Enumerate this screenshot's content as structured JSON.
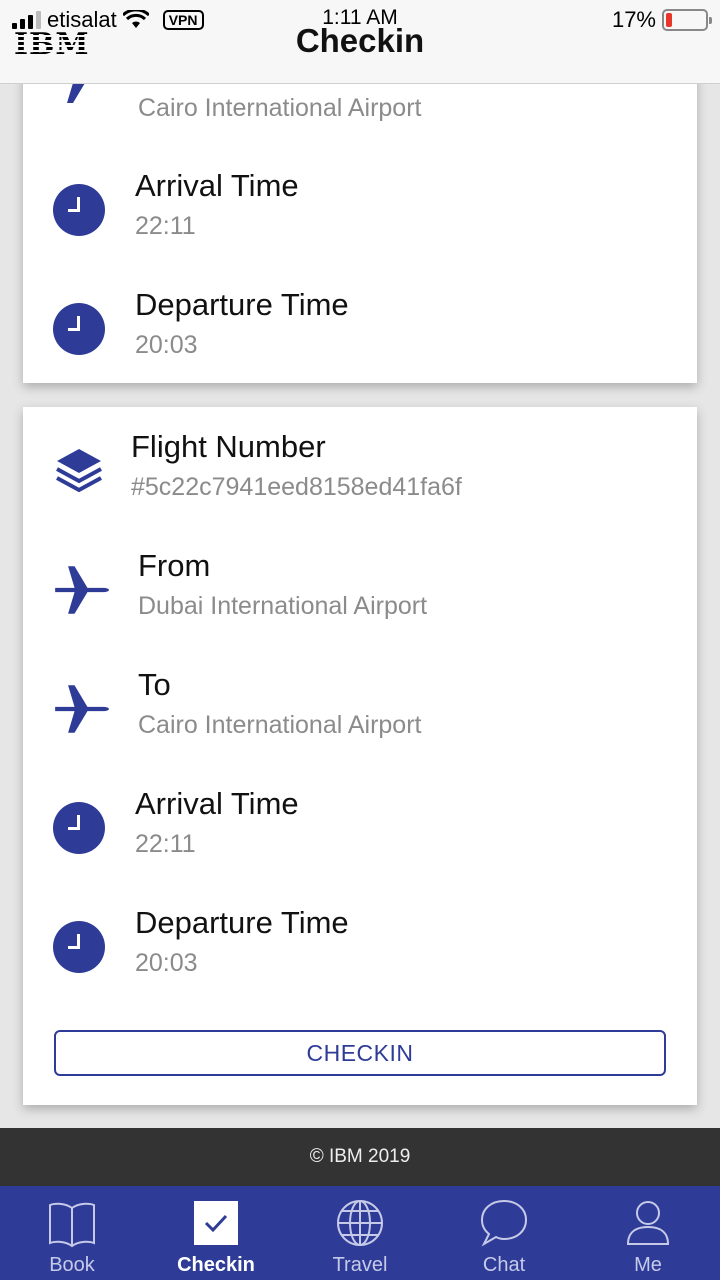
{
  "status_bar": {
    "carrier": "etisalat",
    "vpn": "VPN",
    "time": "1:11 AM",
    "battery": "17%",
    "battery_level": 0.17
  },
  "header": {
    "logo": "IBM",
    "title": "Checkin"
  },
  "card1": {
    "partial_value": "Cairo International Airport",
    "arrival_label": "Arrival Time",
    "arrival_value": "22:11",
    "departure_label": "Departure Time",
    "departure_value": "20:03"
  },
  "card2": {
    "flight_label": "Flight Number",
    "flight_value": "#5c22c7941eed8158ed41fa6f",
    "from_label": "From",
    "from_value": "Dubai International Airport",
    "to_label": "To",
    "to_value": "Cairo International Airport",
    "arrival_label": "Arrival Time",
    "arrival_value": "22:11",
    "departure_label": "Departure Time",
    "departure_value": "20:03",
    "button": "CHECKIN"
  },
  "footer": {
    "text": "© IBM 2019"
  },
  "tabs": [
    {
      "label": "Book",
      "icon": "book-icon"
    },
    {
      "label": "Checkin",
      "icon": "checkbox-icon"
    },
    {
      "label": "Travel",
      "icon": "globe-icon"
    },
    {
      "label": "Chat",
      "icon": "chat-bubble-icon"
    },
    {
      "label": "Me",
      "icon": "user-icon"
    }
  ],
  "colors": {
    "accent": "#2e3c98",
    "footer": "#333333",
    "secondary_text": "#8b8b8b"
  }
}
